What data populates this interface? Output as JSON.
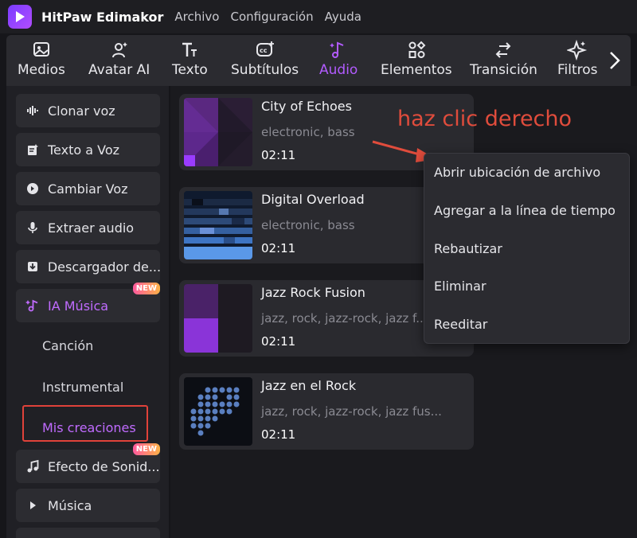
{
  "app": {
    "name": "HitPaw Edimakor",
    "menu": [
      "Archivo",
      "Configuración",
      "Ayuda"
    ]
  },
  "toolbar": {
    "tools": [
      {
        "label": "Medios",
        "icon": "image-icon"
      },
      {
        "label": "Avatar AI",
        "icon": "avatar-icon"
      },
      {
        "label": "Texto",
        "icon": "text-icon"
      },
      {
        "label": "Subtítulos",
        "icon": "subtitles-icon"
      },
      {
        "label": "Audio",
        "icon": "music-note-icon",
        "active": true
      },
      {
        "label": "Elementos",
        "icon": "elements-icon"
      },
      {
        "label": "Transición",
        "icon": "transition-icon"
      },
      {
        "label": "Filtros",
        "icon": "sparkle-icon"
      }
    ]
  },
  "sidebar": {
    "items": [
      {
        "label": "Clonar voz",
        "icon": "waveform-icon"
      },
      {
        "label": "Texto a Voz",
        "icon": "text-to-speech-icon"
      },
      {
        "label": "Cambiar Voz",
        "icon": "voice-change-icon"
      },
      {
        "label": "Extraer audio",
        "icon": "microphone-icon"
      },
      {
        "label": "Descargador de...",
        "icon": "download-icon"
      },
      {
        "label": "IA Música",
        "icon": "ai-music-icon",
        "badge": "NEW",
        "active": true
      },
      {
        "label": "Efecto de Sonid...",
        "icon": "sound-effect-icon",
        "badge": "NEW"
      },
      {
        "label": "Música",
        "icon": "play-triangle-icon"
      }
    ],
    "subitems": [
      "Canción",
      "Instrumental",
      "Mis creaciones"
    ]
  },
  "tracks": [
    {
      "title": "City of Echoes",
      "tags": "electronic, bass",
      "duration": "02:11"
    },
    {
      "title": "Digital Overload",
      "tags": "electronic, bass",
      "duration": "02:11"
    },
    {
      "title": "Jazz Rock Fusion",
      "tags": "jazz, rock, jazz-rock, jazz f...",
      "duration": "02:11"
    },
    {
      "title": "Jazz en el Rock",
      "tags": "jazz, rock, jazz-rock, jazz fus...",
      "duration": "02:11"
    }
  ],
  "context_menu": {
    "items": [
      "Abrir ubicación de archivo",
      "Agregar a la línea de tiempo",
      "Rebautizar",
      "Eliminar",
      "Reeditar"
    ]
  },
  "annotation": {
    "text": "haz clic derecho",
    "color": "#e04c3c"
  },
  "colors": {
    "accent": "#b25bff",
    "highlight": "#e0423a"
  }
}
